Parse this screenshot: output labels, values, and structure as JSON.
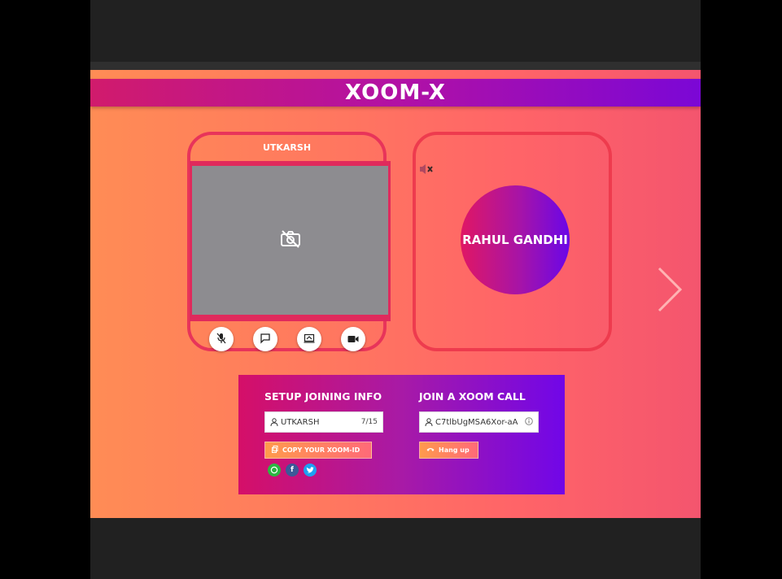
{
  "app": {
    "title": "XOOM-X",
    "colors": {
      "accent_pink": "#d11b6c",
      "accent_purple": "#7b07d6",
      "background_start": "#ff8c55",
      "background_end": "#f4556e",
      "video_placeholder": "#8d8c90"
    }
  },
  "local_participant": {
    "name": "UTKARSH",
    "camera_off_icon": "camera-off-icon",
    "controls": [
      {
        "name": "mic-muted-icon"
      },
      {
        "name": "chat-icon"
      },
      {
        "name": "screen-share-icon"
      },
      {
        "name": "video-camera-icon"
      }
    ]
  },
  "remote_participant": {
    "name": "RAHUL GANDHI",
    "audio_icon": "speaker-muted-icon"
  },
  "navigation": {
    "next_icon": "chevron-right-icon"
  },
  "setup": {
    "heading": "SETUP JOINING INFO",
    "name_value": "UTKARSH",
    "char_count": "7/15",
    "copy_button": "COPY YOUR XOOM-ID",
    "share_icons": [
      "whatsapp-icon",
      "facebook-icon",
      "twitter-icon"
    ]
  },
  "join": {
    "heading": "JOIN A XOOM CALL",
    "id_value": "C7tlbUgMSA6Xor-aA",
    "hangup_button": "Hang up"
  }
}
